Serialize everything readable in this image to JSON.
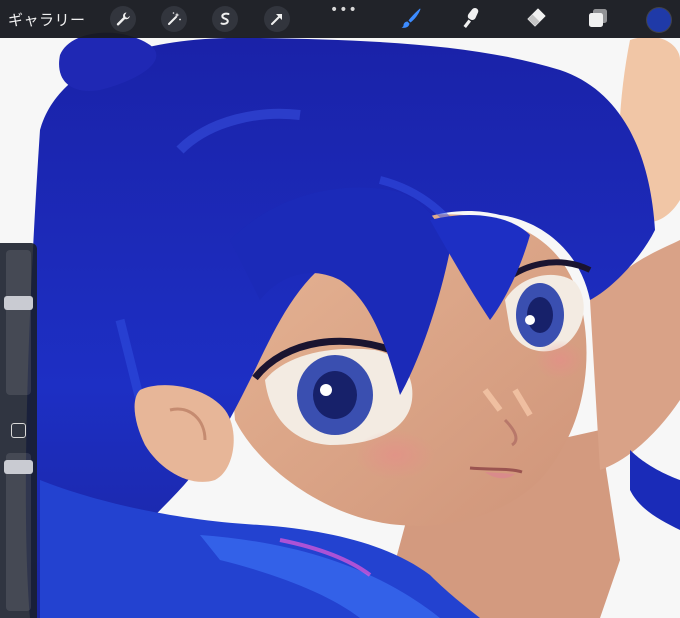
{
  "toolbar": {
    "gallery_label": "ギャラリー",
    "left_tools": [
      {
        "icon": "wrench-icon",
        "name": "actions-button"
      },
      {
        "icon": "magic-wand-icon",
        "name": "adjustments-button"
      },
      {
        "icon": "selection-icon",
        "name": "selection-button"
      },
      {
        "icon": "arrow-cursor-icon",
        "name": "transform-button"
      }
    ],
    "more_label": "•••",
    "right_tools": [
      {
        "icon": "brush-icon",
        "name": "brush-button",
        "active": true
      },
      {
        "icon": "smudge-icon",
        "name": "smudge-button",
        "active": false
      },
      {
        "icon": "eraser-icon",
        "name": "eraser-button",
        "active": false
      },
      {
        "icon": "layers-icon",
        "name": "layers-button",
        "active": false
      }
    ],
    "current_color": "#1f3aa8",
    "active_tool_color": "#3d8cff"
  },
  "sidebar": {
    "brush_size_level": 0.35,
    "brush_opacity_level": 0.05
  },
  "colors": {
    "hair_dark": "#1a1f8a",
    "hair_mid": "#2436c8",
    "skin": "#e0a98a",
    "eye_iris": "#3a4fb0"
  }
}
